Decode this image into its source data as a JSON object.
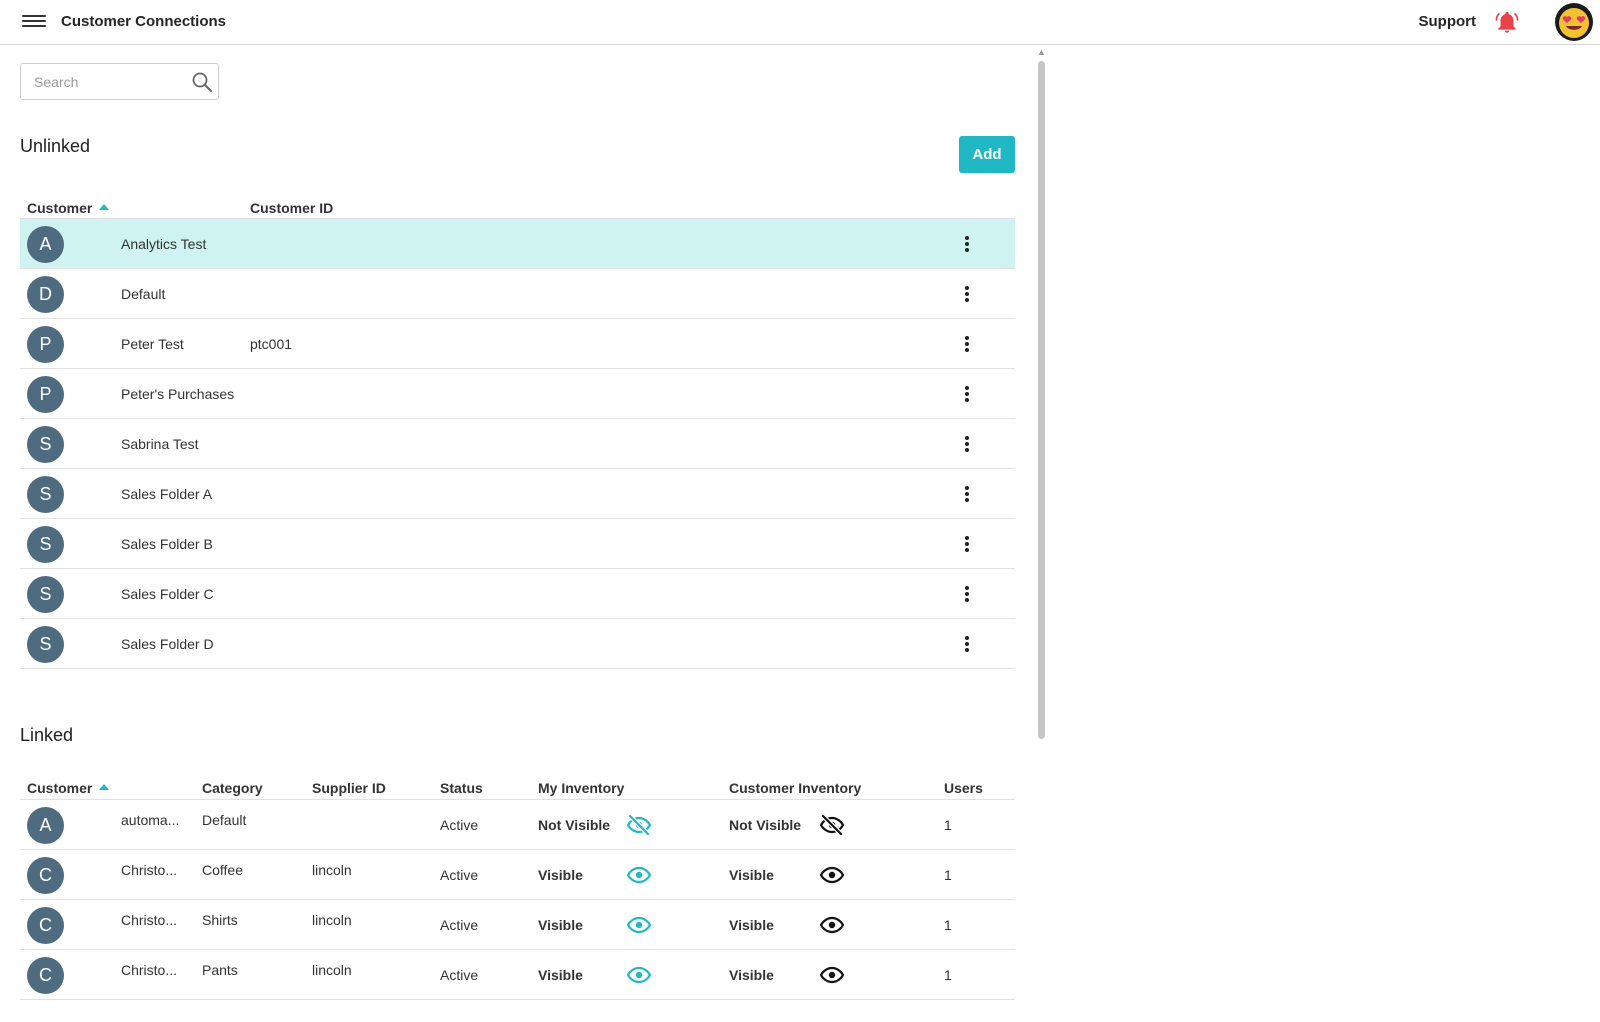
{
  "header": {
    "title": "Customer Connections",
    "support_label": "Support"
  },
  "search": {
    "placeholder": "Search",
    "value": ""
  },
  "unlinked": {
    "title": "Unlinked",
    "add_label": "Add",
    "columns": [
      "Customer",
      "Customer ID"
    ],
    "rows": [
      {
        "initial": "A",
        "name": "Analytics Test",
        "customer_id": ""
      },
      {
        "initial": "D",
        "name": "Default",
        "customer_id": ""
      },
      {
        "initial": "P",
        "name": "Peter Test",
        "customer_id": "ptc001"
      },
      {
        "initial": "P",
        "name": "Peter's Purchases",
        "customer_id": ""
      },
      {
        "initial": "S",
        "name": "Sabrina Test",
        "customer_id": ""
      },
      {
        "initial": "S",
        "name": "Sales Folder A",
        "customer_id": ""
      },
      {
        "initial": "S",
        "name": "Sales Folder B",
        "customer_id": ""
      },
      {
        "initial": "S",
        "name": "Sales Folder C",
        "customer_id": ""
      },
      {
        "initial": "S",
        "name": "Sales Folder D",
        "customer_id": ""
      }
    ]
  },
  "linked": {
    "title": "Linked",
    "columns": [
      "Customer",
      "Category",
      "Supplier ID",
      "Status",
      "My Inventory",
      "Customer Inventory",
      "Users"
    ],
    "rows": [
      {
        "initial": "A",
        "name": "automa...",
        "category": "Default",
        "supplier_id": "",
        "status": "Active",
        "my_inventory": "Not Visible",
        "customer_inventory": "Not Visible",
        "users": "1"
      },
      {
        "initial": "C",
        "name": "Christo...",
        "category": "Coffee",
        "supplier_id": "lincoln",
        "status": "Active",
        "my_inventory": "Visible",
        "customer_inventory": "Visible",
        "users": "1"
      },
      {
        "initial": "C",
        "name": "Christo...",
        "category": "Shirts",
        "supplier_id": "lincoln",
        "status": "Active",
        "my_inventory": "Visible",
        "customer_inventory": "Visible",
        "users": "1"
      },
      {
        "initial": "C",
        "name": "Christo...",
        "category": "Pants",
        "supplier_id": "lincoln",
        "status": "Active",
        "my_inventory": "Visible",
        "customer_inventory": "Visible",
        "users": "1"
      }
    ]
  },
  "colors": {
    "accent": "#1fb8c4",
    "selected_row": "#cff3f1",
    "avatar_circle": "#4f6b80",
    "bell": "#e8424a"
  },
  "icons": {
    "menu": "hamburger-menu-icon",
    "bell": "bell-icon",
    "search": "search-icon",
    "more": "more-vertical-icon",
    "visible": "eye-icon",
    "not_visible": "eye-off-icon"
  }
}
